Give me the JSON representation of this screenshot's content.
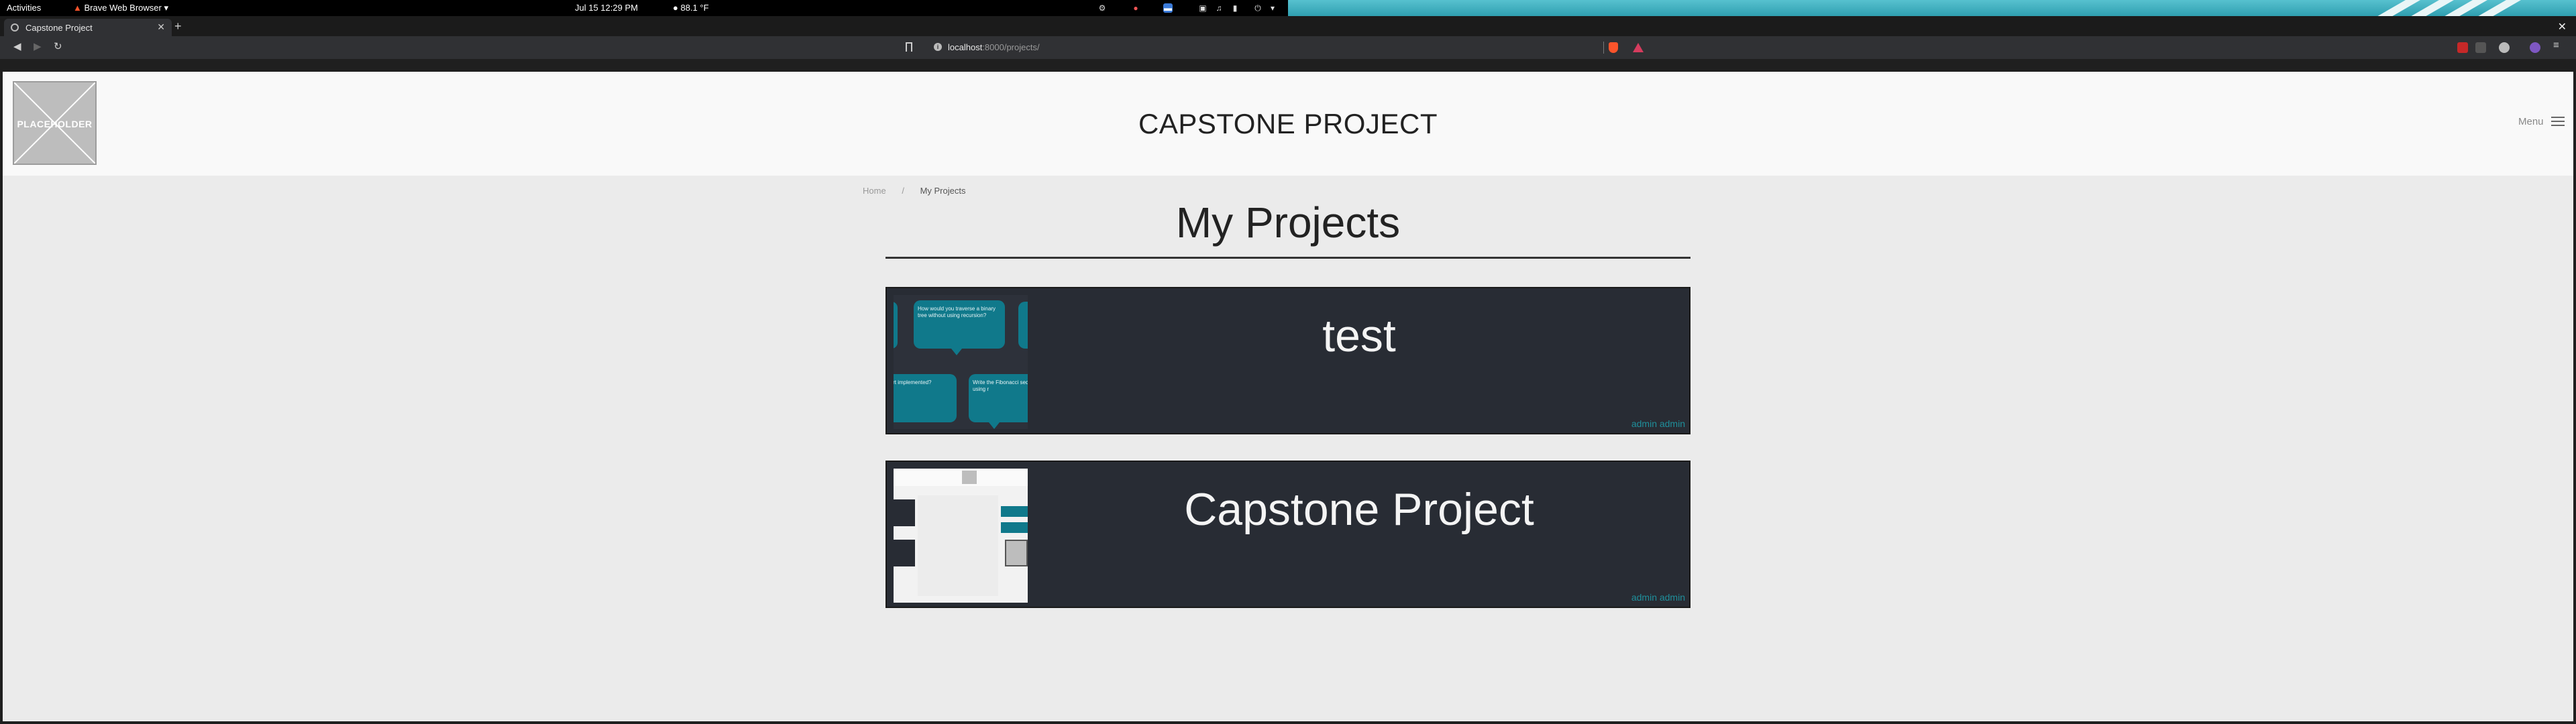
{
  "system_bar": {
    "activities": "Activities",
    "app_menu": "Brave Web Browser",
    "clock": "Jul 15  12:29 PM",
    "weather": "88.1 °F"
  },
  "browser": {
    "tab_title": "Capstone Project",
    "url_host": "localhost",
    "url_rest": ":8000/projects/",
    "colors": {
      "brave_shield": "#fb542b",
      "rewards": "#d63c5e"
    }
  },
  "site": {
    "logo_text": "PLACEHOLDER",
    "title": "CAPSTONE PROJECT",
    "menu_label": "Menu"
  },
  "breadcrumb": {
    "home": "Home",
    "separator": "/",
    "current": "My Projects"
  },
  "page": {
    "heading": "My Projects"
  },
  "projects": [
    {
      "title": "test",
      "author": "admin admin",
      "thumbnail_bubbles": [
        "How would you traverse a binary tree without using recursion?",
        "Is bubble sort implemented?",
        "Write the Fibonacci sequence using r"
      ]
    },
    {
      "title": "Capstone Project",
      "author": "admin admin"
    }
  ],
  "colors": {
    "accent": "#1f8f9b",
    "card_bg": "#282c34",
    "page_bg": "#ebebeb"
  }
}
